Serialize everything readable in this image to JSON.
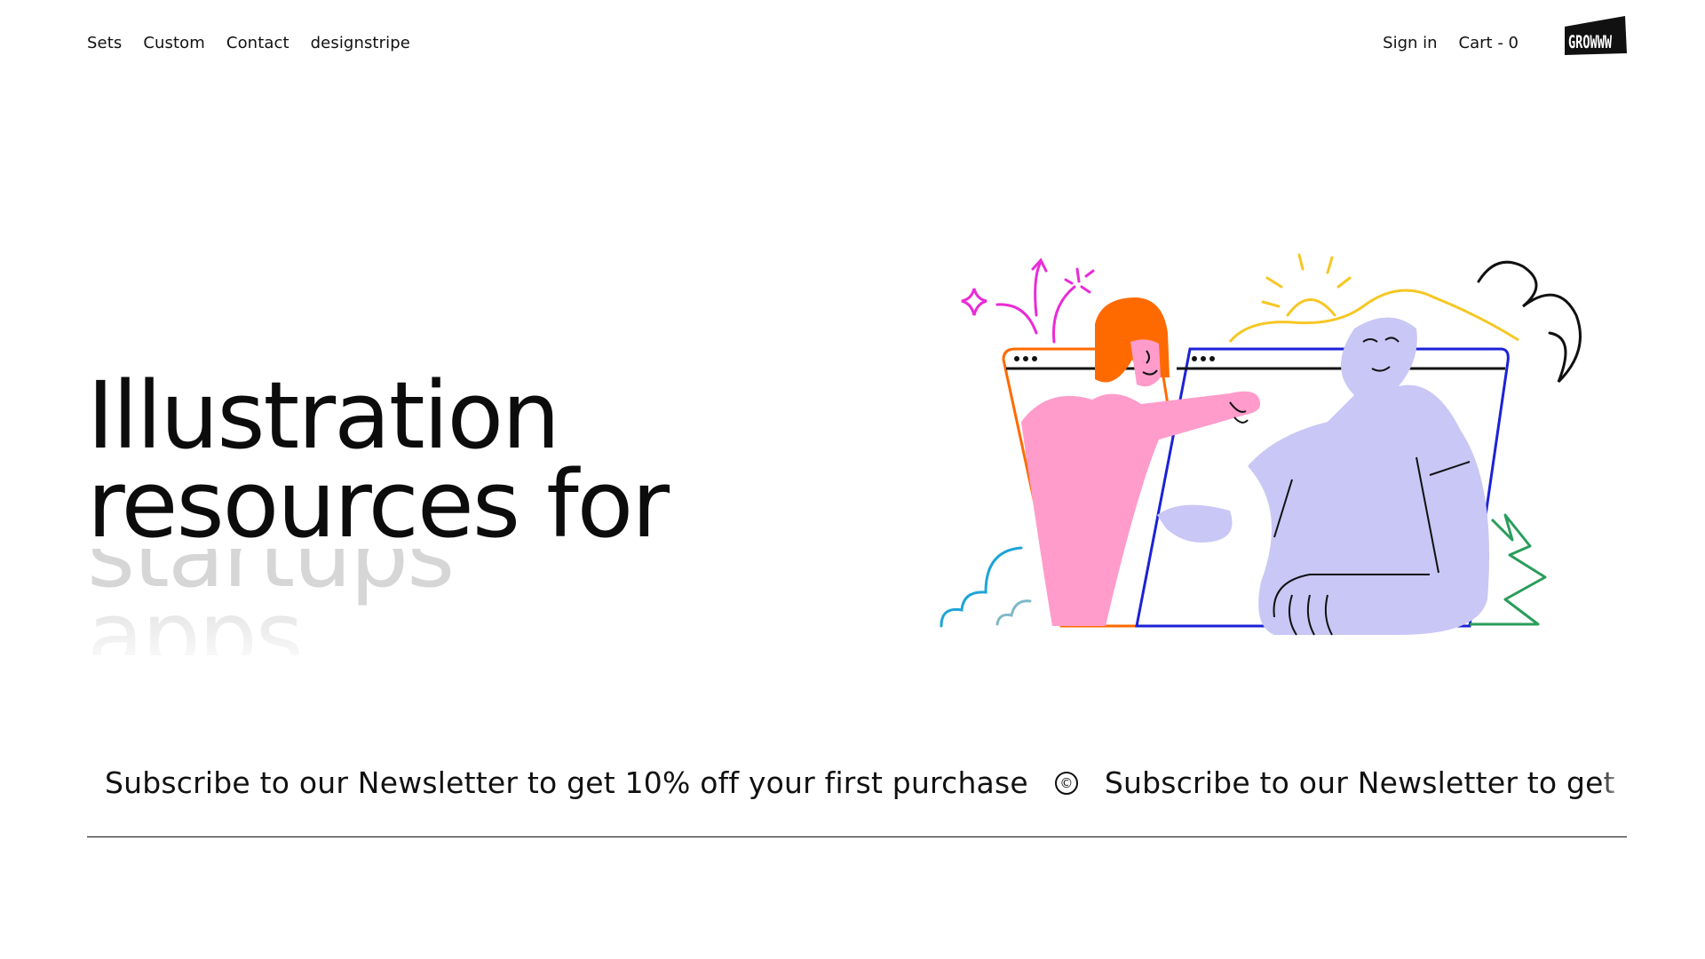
{
  "nav": {
    "links": [
      "Sets",
      "Custom",
      "Contact",
      "designstripe"
    ],
    "sign_in": "Sign in",
    "cart": "Cart - 0"
  },
  "logo": {
    "text": "GROWWW"
  },
  "hero": {
    "line1": "Illustration",
    "line2": "resources for",
    "rotating_words": [
      "startups",
      "apps"
    ]
  },
  "newsletter": {
    "text": "Subscribe to our Newsletter to get 10% off your first purchase",
    "separator_icon": "copyright-icon"
  },
  "colors": {
    "text": "#111111",
    "muted_word": "#d6d6d6",
    "pink": "#ff9ccb",
    "lavender": "#c9c7f5",
    "orange": "#ff6a00",
    "blue": "#1c22d6",
    "magenta": "#ea2bd7",
    "yellow": "#f6c724",
    "green": "#2a9d5c",
    "cyan": "#1ea4d8"
  }
}
